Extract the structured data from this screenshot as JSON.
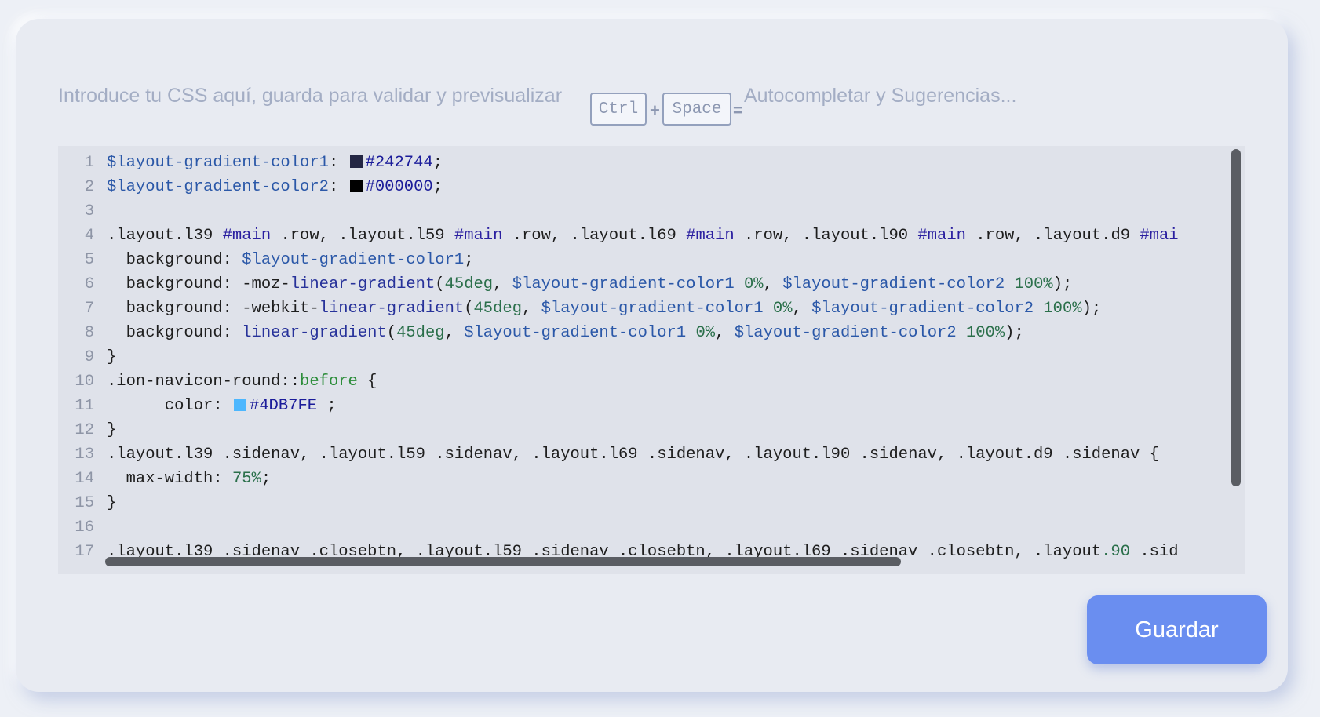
{
  "hint": {
    "text_before": "Introduce tu CSS aquí, guarda para validar y previsualizar",
    "key1": "Ctrl",
    "plus": "+",
    "key2": "Space",
    "equals": "=",
    "text_after": "Autocompletar y Sugerencias..."
  },
  "editor": {
    "lines": [
      {
        "n": "1",
        "parts": [
          {
            "t": "$layout-gradient-color1",
            "c": "var"
          },
          {
            "t": ": "
          },
          {
            "swatch": "#242744"
          },
          {
            "t": "#242744",
            "c": "hex"
          },
          {
            "t": ";"
          }
        ]
      },
      {
        "n": "2",
        "parts": [
          {
            "t": "$layout-gradient-color2",
            "c": "var"
          },
          {
            "t": ": "
          },
          {
            "swatch": "#000000"
          },
          {
            "t": "#000000",
            "c": "hex"
          },
          {
            "t": ";"
          }
        ]
      },
      {
        "n": "3",
        "parts": []
      },
      {
        "n": "4",
        "parts": [
          {
            "t": ".layout.l39 "
          },
          {
            "t": "#main",
            "c": "id"
          },
          {
            "t": " .row, .layout.l59 "
          },
          {
            "t": "#main",
            "c": "id"
          },
          {
            "t": " .row, .layout.l69 "
          },
          {
            "t": "#main",
            "c": "id"
          },
          {
            "t": " .row, .layout.l90 "
          },
          {
            "t": "#main",
            "c": "id"
          },
          {
            "t": " .row, .layout.d9 "
          },
          {
            "t": "#mai",
            "c": "id"
          }
        ]
      },
      {
        "n": "5",
        "parts": [
          {
            "t": "  background: "
          },
          {
            "t": "$layout-gradient-color1",
            "c": "var"
          },
          {
            "t": ";"
          }
        ]
      },
      {
        "n": "6",
        "parts": [
          {
            "t": "  background: -moz-"
          },
          {
            "t": "linear-gradient",
            "c": "kw"
          },
          {
            "t": "("
          },
          {
            "t": "45deg",
            "c": "num"
          },
          {
            "t": ", "
          },
          {
            "t": "$layout-gradient-color1",
            "c": "var"
          },
          {
            "t": " "
          },
          {
            "t": "0%",
            "c": "num"
          },
          {
            "t": ", "
          },
          {
            "t": "$layout-gradient-color2",
            "c": "var"
          },
          {
            "t": " "
          },
          {
            "t": "100%",
            "c": "num"
          },
          {
            "t": ");"
          }
        ]
      },
      {
        "n": "7",
        "parts": [
          {
            "t": "  background: -webkit-"
          },
          {
            "t": "linear-gradient",
            "c": "kw"
          },
          {
            "t": "("
          },
          {
            "t": "45deg",
            "c": "num"
          },
          {
            "t": ", "
          },
          {
            "t": "$layout-gradient-color1",
            "c": "var"
          },
          {
            "t": " "
          },
          {
            "t": "0%",
            "c": "num"
          },
          {
            "t": ", "
          },
          {
            "t": "$layout-gradient-color2",
            "c": "var"
          },
          {
            "t": " "
          },
          {
            "t": "100%",
            "c": "num"
          },
          {
            "t": ");"
          }
        ]
      },
      {
        "n": "8",
        "parts": [
          {
            "t": "  background: "
          },
          {
            "t": "linear-gradient",
            "c": "kw"
          },
          {
            "t": "("
          },
          {
            "t": "45deg",
            "c": "num"
          },
          {
            "t": ", "
          },
          {
            "t": "$layout-gradient-color1",
            "c": "var"
          },
          {
            "t": " "
          },
          {
            "t": "0%",
            "c": "num"
          },
          {
            "t": ", "
          },
          {
            "t": "$layout-gradient-color2",
            "c": "var"
          },
          {
            "t": " "
          },
          {
            "t": "100%",
            "c": "num"
          },
          {
            "t": ");"
          }
        ]
      },
      {
        "n": "9",
        "parts": [
          {
            "t": "}"
          }
        ]
      },
      {
        "n": "10",
        "parts": [
          {
            "t": ".ion-navicon-round::"
          },
          {
            "t": "before",
            "c": "pseudo"
          },
          {
            "t": " {"
          }
        ]
      },
      {
        "n": "11",
        "parts": [
          {
            "t": "      color: "
          },
          {
            "swatch": "#4DB7FE"
          },
          {
            "t": "#4DB7FE",
            "c": "hex"
          },
          {
            "t": " ;"
          }
        ]
      },
      {
        "n": "12",
        "parts": [
          {
            "t": "}"
          }
        ]
      },
      {
        "n": "13",
        "parts": [
          {
            "t": ".layout.l39 .sidenav, .layout.l59 .sidenav, .layout.l69 .sidenav, .layout.l90 .sidenav, .layout.d9 .sidenav {"
          }
        ]
      },
      {
        "n": "14",
        "parts": [
          {
            "t": "  max-width: "
          },
          {
            "t": "75%",
            "c": "num"
          },
          {
            "t": ";"
          }
        ]
      },
      {
        "n": "15",
        "parts": [
          {
            "t": "}"
          }
        ]
      },
      {
        "n": "16",
        "parts": []
      },
      {
        "n": "17",
        "parts": [
          {
            "t": ".layout.l39 .sidenav .closebtn, .layout.l59 .sidenav .closebtn, .layout.l69 .sidenav .closebtn, .layout"
          },
          {
            "t": ".90",
            "c": "num"
          },
          {
            "t": " .sid"
          }
        ]
      }
    ]
  },
  "save_button": {
    "label": "Guardar"
  },
  "colors": {
    "accent": "#6a8ef0",
    "swatch1": "#242744",
    "swatch2": "#000000",
    "swatch3": "#4DB7FE"
  }
}
